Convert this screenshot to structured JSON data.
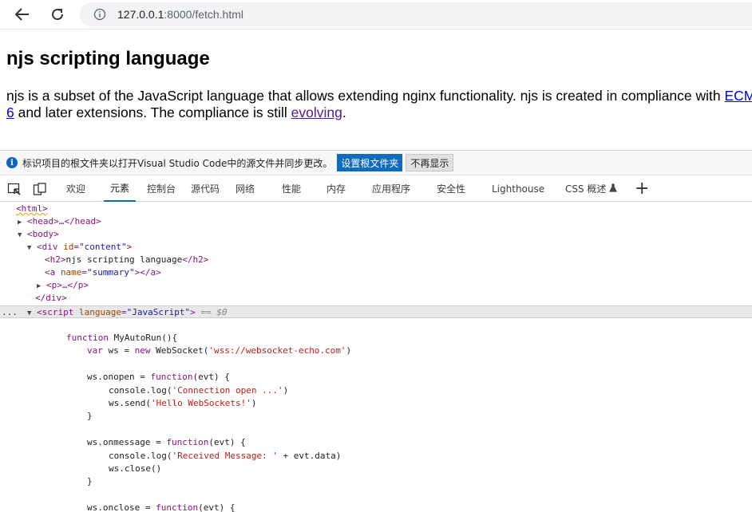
{
  "browser": {
    "url_host": "127.0.0.1",
    "url_path": ":8000/fetch.html"
  },
  "page": {
    "heading": "njs scripting language",
    "para_part1": "njs is a subset of the JavaScript language that allows extending nginx functionality. njs is created in compliance with ",
    "link_ecma": "ECMA",
    "line2_link": "6",
    "para_part2": " and later extensions. The compliance is still ",
    "link_evolving": "evolving",
    "para_end": "."
  },
  "notice": {
    "message": "标识项目的根文件夹以打开Visual Studio Code中的源文件并同步更改。",
    "primary_button": "设置根文件夹",
    "secondary_button": "不再显示"
  },
  "devtools_tabs": [
    "欢迎",
    "元素",
    "控制台",
    "源代码",
    "网络",
    "性能",
    "内存",
    "应用程序",
    "安全性",
    "Lighthouse",
    "CSS 概述"
  ],
  "dom": {
    "html": "<html>",
    "head": "<head>…</head>",
    "body": "<body>",
    "div_open_tag": "<div",
    "div_attr": "id",
    "div_val": "\"content\"",
    "h2_open": "<h2>",
    "h2_text": "njs scripting language",
    "h2_close": "</h2>",
    "a_open": "<a",
    "a_attr": "name",
    "a_val": "\"summary\"",
    "a_close": "></a>",
    "p": "<p>…</p>",
    "div_close": "</div>",
    "script_open": "<script",
    "script_attr": "language",
    "script_val": "\"JavaScript\"",
    "script_gt": ">",
    "selected_marker": "== $0",
    "ellipsis": "..."
  },
  "code": {
    "l1_kw": "function",
    "l1_rest": " MyAutoRun(){",
    "l2_kw": "var",
    "l2_mid": " ws = ",
    "l2_kw2": "new",
    "l2_rest": " WebSocket(",
    "l2_str": "'wss://websocket-echo.com'",
    "l2_end": ")",
    "l3_pre": "ws.onopen = ",
    "l3_kw": "function",
    "l3_rest": "(evt) {",
    "l4_pre": "console.log(",
    "l4_str": "'Connection open ...'",
    "l4_end": ")",
    "l5_pre": "ws.send(",
    "l5_str": "'Hello WebSockets!'",
    "l5_end": ")",
    "l6": "}",
    "l7_pre": "ws.onmessage = ",
    "l7_kw": "function",
    "l7_rest": "(evt) {",
    "l8_pre": "console.log(",
    "l8_str": "'Received Message: '",
    "l8_end": " + evt.data)",
    "l9": "ws.close()",
    "l10": "}",
    "l11_pre": "ws.onclose = ",
    "l11_kw": "function",
    "l11_rest": "(evt) {"
  }
}
